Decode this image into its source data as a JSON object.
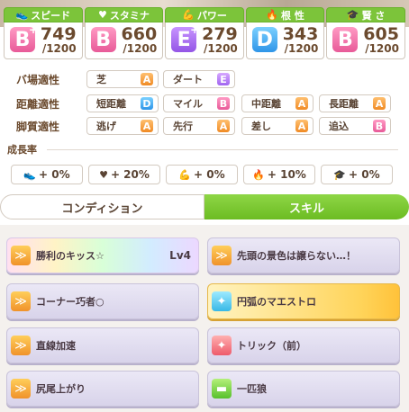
{
  "stats": [
    {
      "label": "スピード",
      "icon": "shoe-icon",
      "grade": "B",
      "plus": "+",
      "value": "749",
      "max": "/1200",
      "grade_class": "g-B"
    },
    {
      "label": "スタミナ",
      "icon": "heart-icon",
      "grade": "B",
      "plus": "",
      "value": "660",
      "max": "/1200",
      "grade_class": "g-B"
    },
    {
      "label": "パワー",
      "icon": "muscle-icon",
      "grade": "E",
      "plus": "+",
      "value": "279",
      "max": "/1200",
      "grade_class": "g-E"
    },
    {
      "label": "根 性",
      "icon": "flame-icon",
      "grade": "D",
      "plus": "",
      "value": "343",
      "max": "/1200",
      "grade_class": "g-D"
    },
    {
      "label": "賢 さ",
      "icon": "mortarboard-icon",
      "grade": "B",
      "plus": "",
      "value": "605",
      "max": "/1200",
      "grade_class": "g-B"
    }
  ],
  "aptitude": {
    "track": {
      "label": "バ場適性",
      "items": [
        {
          "name": "芝",
          "grade": "A"
        },
        {
          "name": "ダート",
          "grade": "E"
        }
      ]
    },
    "distance": {
      "label": "距離適性",
      "items": [
        {
          "name": "短距離",
          "grade": "D"
        },
        {
          "name": "マイル",
          "grade": "B"
        },
        {
          "name": "中距離",
          "grade": "A"
        },
        {
          "name": "長距離",
          "grade": "A"
        }
      ]
    },
    "style": {
      "label": "脚質適性",
      "items": [
        {
          "name": "逃げ",
          "grade": "A"
        },
        {
          "name": "先行",
          "grade": "A"
        },
        {
          "name": "差し",
          "grade": "A"
        },
        {
          "name": "追込",
          "grade": "B"
        }
      ]
    }
  },
  "growth": {
    "label": "成長率",
    "items": [
      {
        "icon": "shoe-icon",
        "value": "+ 0%"
      },
      {
        "icon": "heart-icon",
        "value": "+ 20%"
      },
      {
        "icon": "muscle-icon",
        "value": "+ 0%"
      },
      {
        "icon": "flame-icon",
        "value": "+ 10%"
      },
      {
        "icon": "mortarboard-icon",
        "value": "+ 0%"
      }
    ]
  },
  "tabs": {
    "condition": "コンディション",
    "skill": "スキル",
    "active": "skill"
  },
  "skills": [
    {
      "name": "勝利のキッス☆",
      "level": "Lv4",
      "style": "rainbow",
      "icon": "speed-skill-icon"
    },
    {
      "name": "先頭の景色は譲らない…！",
      "level": "",
      "style": "normal",
      "icon": "speed-skill-icon"
    },
    {
      "name": "コーナー巧者○",
      "level": "",
      "style": "normal",
      "icon": "speed-skill-icon"
    },
    {
      "name": "円弧のマエストロ",
      "level": "",
      "style": "gold",
      "icon": "recovery-skill-icon"
    },
    {
      "name": "直線加速",
      "level": "",
      "style": "normal",
      "icon": "speed-skill-icon"
    },
    {
      "name": "トリック（前）",
      "level": "",
      "style": "normal",
      "icon": "debuff-skill-icon"
    },
    {
      "name": "尻尾上がり",
      "level": "",
      "style": "normal",
      "icon": "speed-skill-icon"
    },
    {
      "name": "一匹狼",
      "level": "",
      "style": "normal",
      "icon": "green-skill-icon"
    }
  ]
}
